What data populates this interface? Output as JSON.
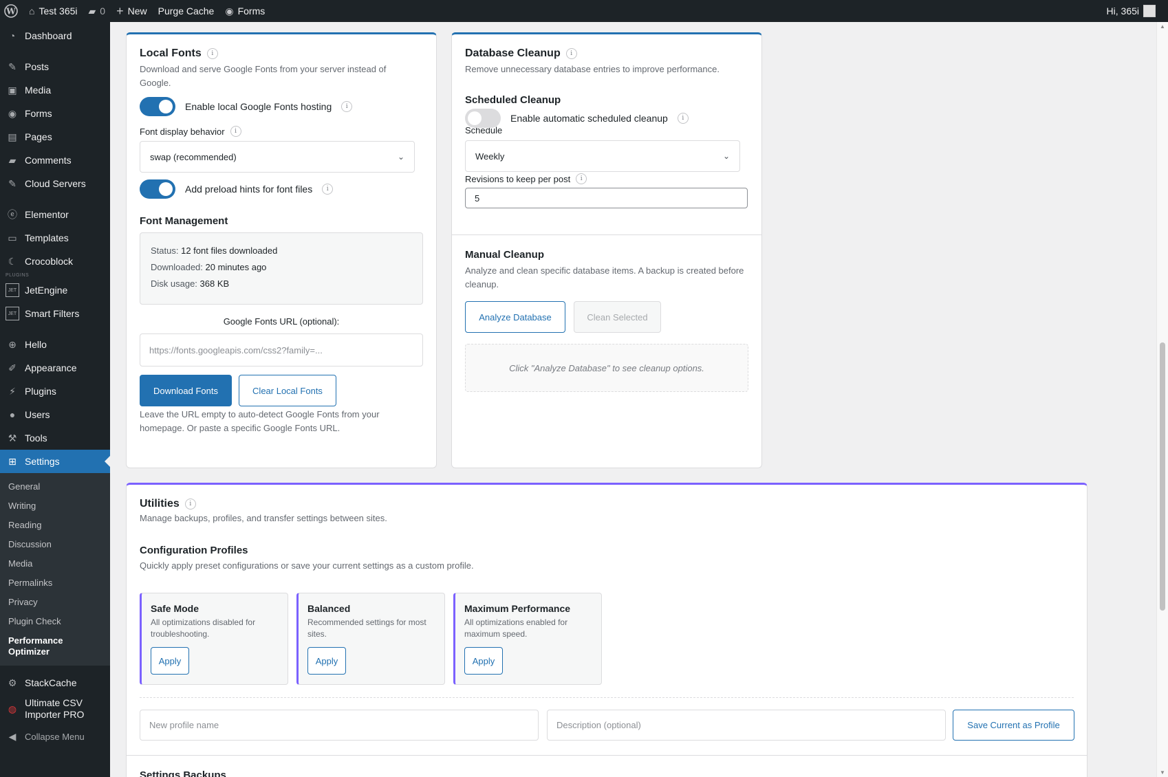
{
  "adminbar": {
    "site_name": "Test 365i",
    "comments_count": "0",
    "new_label": "New",
    "purge_label": "Purge Cache",
    "forms_label": "Forms",
    "greeting": "Hi, 365i"
  },
  "sidebar": {
    "items": [
      {
        "label": "Dashboard",
        "icon": "dashboard-icon"
      },
      {
        "label": "Posts",
        "icon": "pin-icon"
      },
      {
        "label": "Media",
        "icon": "media-icon"
      },
      {
        "label": "Forms",
        "icon": "forms-icon"
      },
      {
        "label": "Pages",
        "icon": "pages-icon"
      },
      {
        "label": "Comments",
        "icon": "comment-icon"
      },
      {
        "label": "Cloud Servers",
        "icon": "pin-icon"
      },
      {
        "label": "Elementor",
        "icon": "elementor-icon"
      },
      {
        "label": "Templates",
        "icon": "folder-icon"
      },
      {
        "label": "Crocoblock",
        "icon": "crocoblock-icon"
      },
      {
        "label": "JetEngine",
        "icon": "jet-icon"
      },
      {
        "label": "Smart Filters",
        "icon": "jet-icon"
      },
      {
        "label": "Hello",
        "icon": "plus-circle-icon"
      },
      {
        "label": "Appearance",
        "icon": "brush-icon"
      },
      {
        "label": "Plugins",
        "icon": "plug-icon"
      },
      {
        "label": "Users",
        "icon": "user-icon"
      },
      {
        "label": "Tools",
        "icon": "wrench-icon"
      },
      {
        "label": "Settings",
        "icon": "settings-icon"
      },
      {
        "label": "StackCache",
        "icon": "gear-icon"
      },
      {
        "label": "Ultimate CSV Importer PRO",
        "icon": "csv-icon"
      },
      {
        "label": "Collapse Menu",
        "icon": "collapse-icon"
      }
    ],
    "plugins_tag": "PLUGINS",
    "submenu": [
      "General",
      "Writing",
      "Reading",
      "Discussion",
      "Media",
      "Permalinks",
      "Privacy",
      "Plugin Check",
      "Performance Optimizer"
    ]
  },
  "local_fonts": {
    "title": "Local Fonts",
    "description": "Download and serve Google Fonts from your server instead of Google.",
    "enable_label": "Enable local Google Fonts hosting",
    "enable_on": true,
    "display_label": "Font display behavior",
    "display_value": "swap (recommended)",
    "preload_label": "Add preload hints for font files",
    "preload_on": true,
    "mgmt_title": "Font Management",
    "status_label": "Status:",
    "status_value": "12 font files downloaded",
    "downloaded_label": "Downloaded:",
    "downloaded_value": "20 minutes ago",
    "disk_label": "Disk usage:",
    "disk_value": "368 KB",
    "url_label": "Google Fonts URL (optional):",
    "url_placeholder": "https://fonts.googleapis.com/css2?family=...",
    "download_btn": "Download Fonts",
    "clear_btn": "Clear Local Fonts",
    "help": "Leave the URL empty to auto-detect Google Fonts from your homepage. Or paste a specific Google Fonts URL."
  },
  "db_cleanup": {
    "title": "Database Cleanup",
    "description": "Remove unnecessary database entries to improve performance.",
    "scheduled_title": "Scheduled Cleanup",
    "auto_label": "Enable automatic scheduled cleanup",
    "auto_on": false,
    "schedule_label": "Schedule",
    "schedule_value": "Weekly",
    "revisions_label": "Revisions to keep per post",
    "revisions_value": "5",
    "manual_title": "Manual Cleanup",
    "manual_desc": "Analyze and clean specific database items. A backup is created before cleanup.",
    "analyze_btn": "Analyze Database",
    "clean_btn": "Clean Selected",
    "placeholder": "Click \"Analyze Database\" to see cleanup options."
  },
  "utilities": {
    "title": "Utilities",
    "description": "Manage backups, profiles, and transfer settings between sites.",
    "profiles_title": "Configuration Profiles",
    "profiles_desc": "Quickly apply preset configurations or save your current settings as a custom profile.",
    "profiles": [
      {
        "name": "Safe Mode",
        "desc": "All optimizations disabled for troubleshooting.",
        "apply": "Apply"
      },
      {
        "name": "Balanced",
        "desc": "Recommended settings for most sites.",
        "apply": "Apply"
      },
      {
        "name": "Maximum Performance",
        "desc": "All optimizations enabled for maximum speed.",
        "apply": "Apply"
      }
    ],
    "profile_name_placeholder": "New profile name",
    "profile_desc_placeholder": "Description (optional)",
    "save_btn": "Save Current as Profile",
    "backups_title": "Settings Backups"
  },
  "colors": {
    "accent": "#2271b1",
    "utilities_accent": "#7b61ff",
    "sidebar_bg": "#1d2327"
  }
}
